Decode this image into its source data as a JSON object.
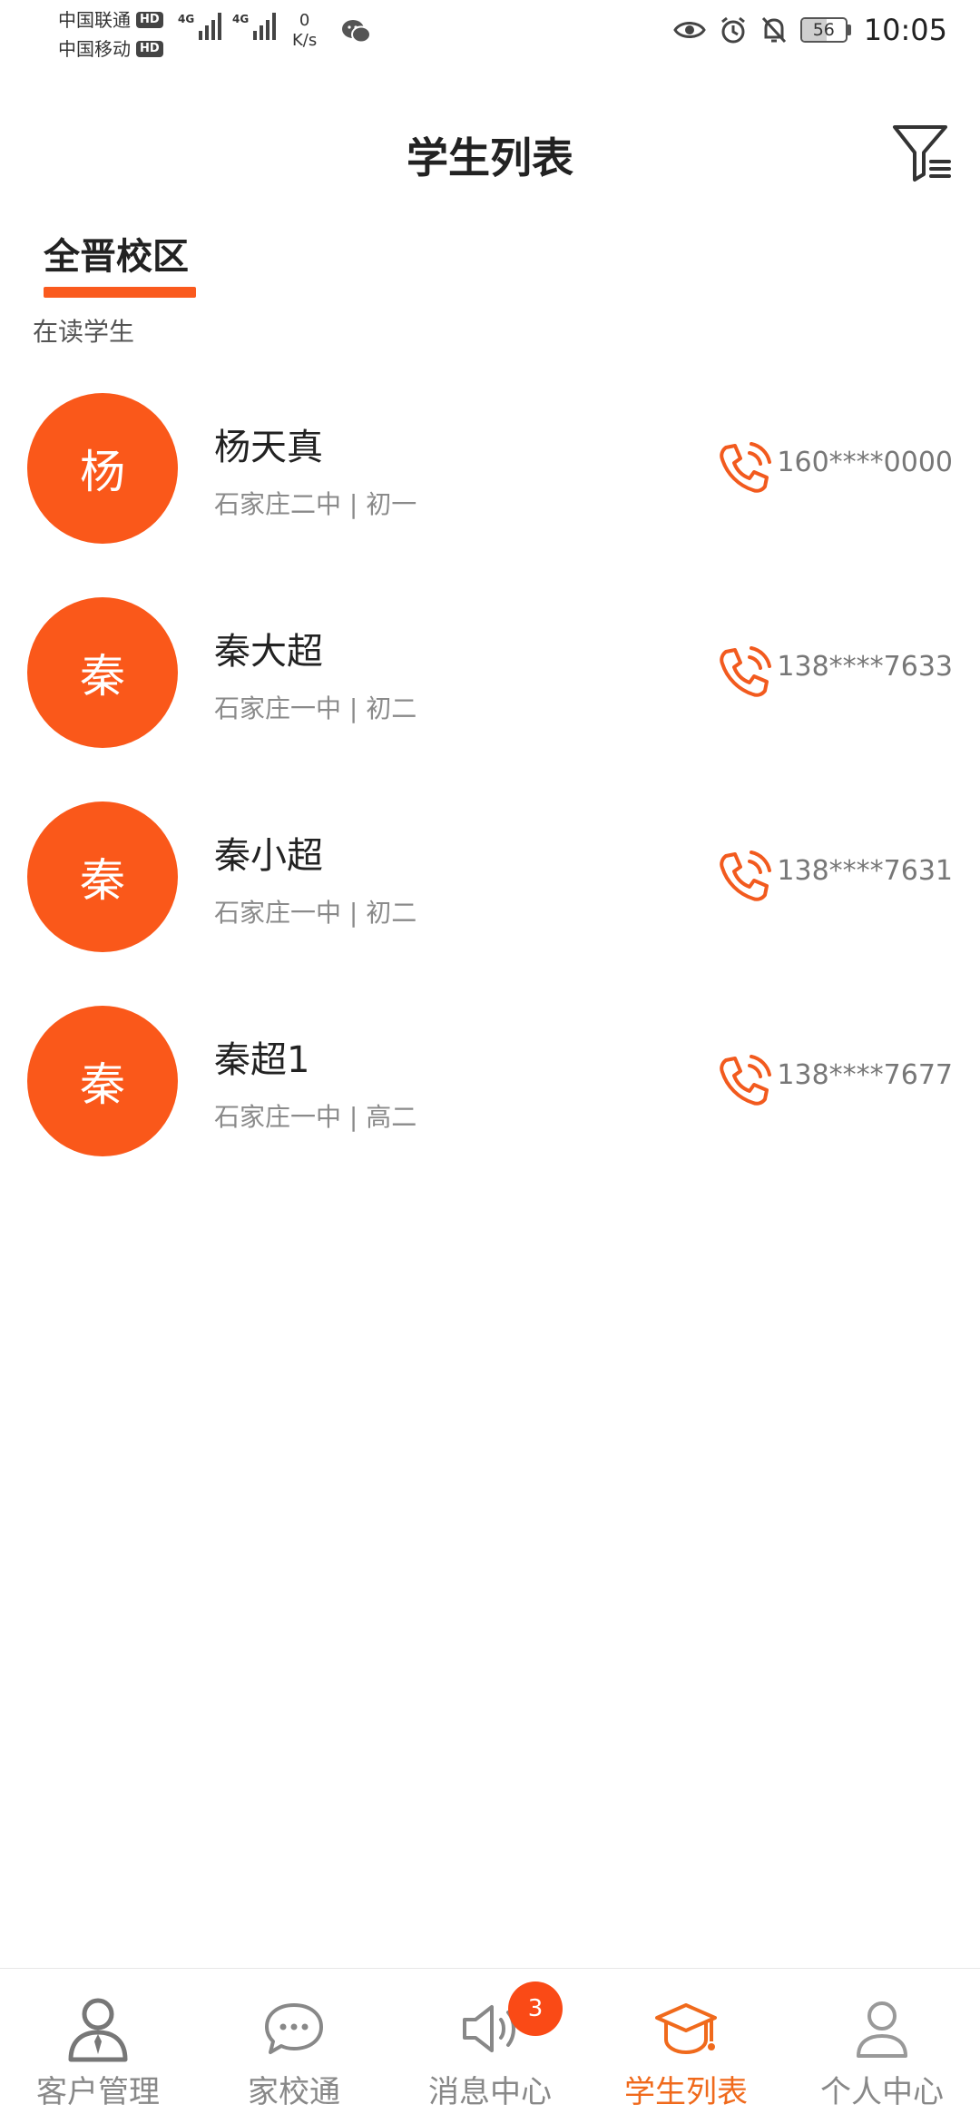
{
  "status_bar": {
    "carrier1": "中国联通",
    "carrier2": "中国移动",
    "hd": "HD",
    "net1": "4G",
    "net2": "4G",
    "speed_value": "0",
    "speed_unit": "K/s",
    "battery": "56",
    "battery_level": 0.56,
    "time": "10:05"
  },
  "header": {
    "title": "学生列表"
  },
  "tabs": [
    {
      "label": "全晋校区",
      "active": true
    }
  ],
  "section": {
    "label": "在读学生"
  },
  "students": [
    {
      "avatar": "杨",
      "name": "杨天真",
      "school": "石家庄二中 | 初一",
      "phone": "160****0000"
    },
    {
      "avatar": "秦",
      "name": "秦大超",
      "school": "石家庄一中 | 初二",
      "phone": "138****7633"
    },
    {
      "avatar": "秦",
      "name": "秦小超",
      "school": "石家庄一中 | 初二",
      "phone": "138****7631"
    },
    {
      "avatar": "秦",
      "name": "秦超1",
      "school": "石家庄一中 | 高二",
      "phone": "138****7677"
    }
  ],
  "bottom_nav": {
    "items": [
      {
        "label": "客户管理",
        "icon": "customer-icon"
      },
      {
        "label": "家校通",
        "icon": "chat-icon"
      },
      {
        "label": "消息中心",
        "icon": "speaker-icon",
        "badge": "3"
      },
      {
        "label": "学生列表",
        "icon": "graduation-cap-icon",
        "active": true
      },
      {
        "label": "个人中心",
        "icon": "person-icon"
      }
    ]
  },
  "colors": {
    "accent": "#fa581a",
    "nav_active": "#f06a1c",
    "badge": "#fa4a16"
  }
}
